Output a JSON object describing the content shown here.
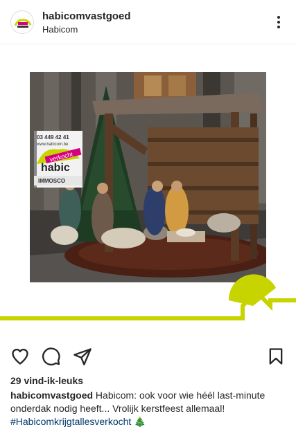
{
  "header": {
    "username": "habicomvastgoed",
    "subtitle": "Habicom"
  },
  "icons": {
    "more": "more-vertical-icon",
    "like": "heart-icon",
    "comment": "comment-icon",
    "share": "send-icon",
    "save": "bookmark-icon"
  },
  "post": {
    "sign": {
      "phone": "03 449 42 41",
      "website": "www.habicom.be",
      "brand": "habic",
      "sold_banner": "verkocht",
      "immo": "IMMOSCO"
    }
  },
  "colors": {
    "brand_green": "#c8d400",
    "sold_pink": "#d6007e",
    "hashtag": "#00376b"
  },
  "stats": {
    "likes": "29 vind-ik-leuks"
  },
  "caption": {
    "username": "habicomvastgoed",
    "text": "Habicom: ook voor wie héél last-minute onderdak nodig heeft... Vrolijk kerstfeest allemaal!",
    "hashtag": "#Habicomkrijgtallesverkocht",
    "emoji": "🎄"
  }
}
